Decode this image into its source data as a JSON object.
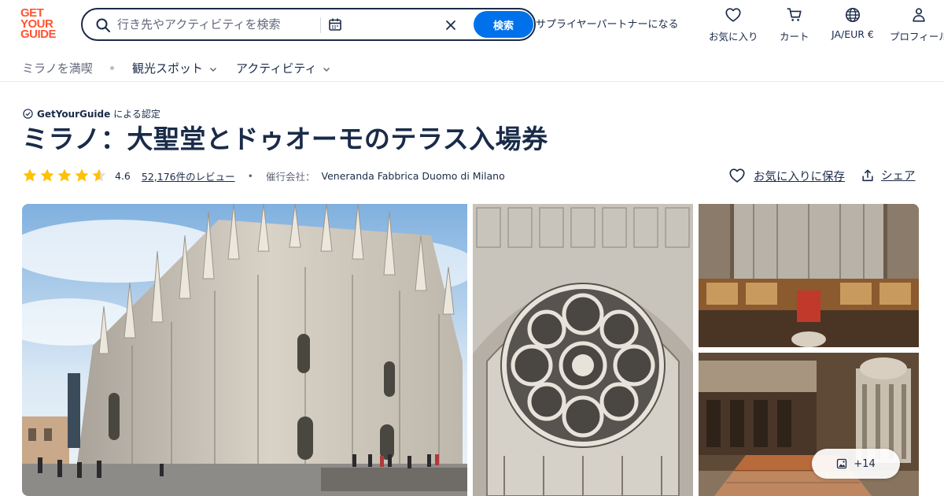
{
  "header": {
    "logo": [
      "GET",
      "YOUR",
      "GUIDE"
    ],
    "search": {
      "placeholder": "行き先やアクティビティを検索",
      "button_label": "検索"
    },
    "supplier_link": "サプライヤーパートナーになる",
    "nav": {
      "wishlist": "お気に入り",
      "cart": "カート",
      "locale": "JA/EUR €",
      "profile": "プロフィール"
    }
  },
  "subnav": {
    "explore": "ミラノを満喫",
    "sights": "観光スポット",
    "activities": "アクティビティ"
  },
  "product": {
    "certified_brand": "GetYourGuide",
    "certified_suffix": "による認定",
    "title": "ミラノ：大聖堂とドゥオーモのテラス入場券",
    "rating": "4.6",
    "rating_value": 4.6,
    "reviews": "52,176件のレビュー",
    "operator_label": "催行会社：",
    "operator": "Veneranda Fabbrica Duomo di Milano",
    "save_label": "お気に入りに保存",
    "share_label": "シェア"
  },
  "gallery": {
    "more_label": "+14"
  },
  "colors": {
    "brand": "#ff5533",
    "primary": "#0071eb",
    "text": "#1a2b49",
    "star": "#ffc107"
  }
}
